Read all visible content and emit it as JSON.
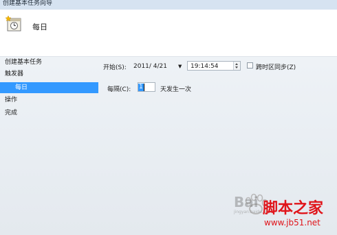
{
  "window": {
    "title": "创建基本任务向导"
  },
  "header": {
    "title": "每日",
    "icon": "task-calendar-star-icon"
  },
  "sidebar": {
    "items": [
      {
        "label": "创建基本任务",
        "selected": false
      },
      {
        "label": "触发器",
        "selected": false
      },
      {
        "label": "每日",
        "selected": true
      },
      {
        "label": "操作",
        "selected": false
      },
      {
        "label": "完成",
        "selected": false
      }
    ]
  },
  "form": {
    "start_label": "开始(S):",
    "start_date": "2011/ 4/21",
    "start_time": "19:14:54",
    "sync_timezone_label": "跨时区同步(Z)",
    "sync_timezone_checked": false,
    "recur_label": "每隔(C):",
    "recur_value": "1",
    "recur_suffix": "天发生一次"
  },
  "watermark": {
    "brand": "Bai",
    "site_name": "脚本之家",
    "site_url": "www.jb51.net",
    "sub_url": "jingyan.baidu.com"
  },
  "colors": {
    "selection": "#3399ff",
    "titlebar": "#d6e3f1",
    "watermark_red": "#e0141a"
  }
}
